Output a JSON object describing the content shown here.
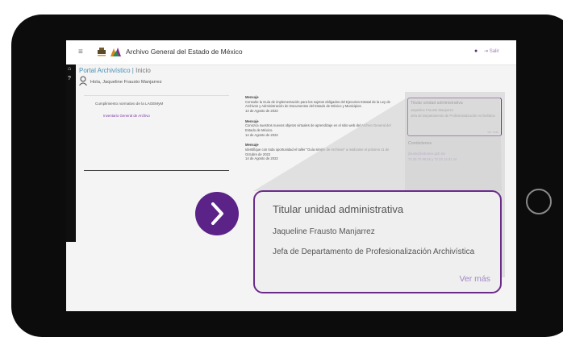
{
  "header": {
    "app_title": "Archivo General del Estado de México",
    "logout_label": "Salir",
    "menu_icon": "menu-icon",
    "user_icon": "user-icon"
  },
  "sidebar": {
    "icons": [
      "home-icon",
      "help-icon"
    ]
  },
  "portal": {
    "title": "Portal Archivístico",
    "breadcrumb": "Inicio",
    "greeting": "Hola, Jaqueline Frausto Manjarrez"
  },
  "compliance": {
    "title": "Cumplimiento normativo de la LAGEMyM",
    "link": "Inventario General de Archivo"
  },
  "messages": [
    {
      "label": "Mensaje",
      "text": "Consulte la Guía de implementación para los sujetos obligados del Ejecutivo Estatal de la Ley de Archivos y Administración de Documentos del Estado de México y Municipios.",
      "date": "14 de Agosto de 2022"
    },
    {
      "label": "Mensaje",
      "text": "Conozca nuestros nuevos objetos virtuales de aprendizaje en el sitio web del Archivo General del Estado de México.",
      "date": "14 de Agosto de 2022"
    },
    {
      "label": "Mensaje",
      "text": "Identifique con toda oportunidad el taller \"Guía simple de Archivos\" a realizarse el próximo 11 de Octubre de 2022",
      "date": "14 de Agosto de 2022"
    }
  ],
  "titular_card": {
    "title": "Titular unidad administrativa",
    "name": "Jaqueline Frausto Manjarrez",
    "role": "Jefa de Departamento de Profesionalización Archivística",
    "more": "Ver más"
  },
  "contacts": {
    "title": "Contáctenos",
    "email": "jfausto@edomex.gob.mx",
    "phone": "72 20 70 96 55 y 72 22 14 01 44"
  },
  "colors": {
    "accent_purple": "#5b2287",
    "link_lilac": "#a187c4",
    "portal_blue": "#4a8fb3"
  },
  "icons": {
    "next": "chevron-right-icon"
  }
}
